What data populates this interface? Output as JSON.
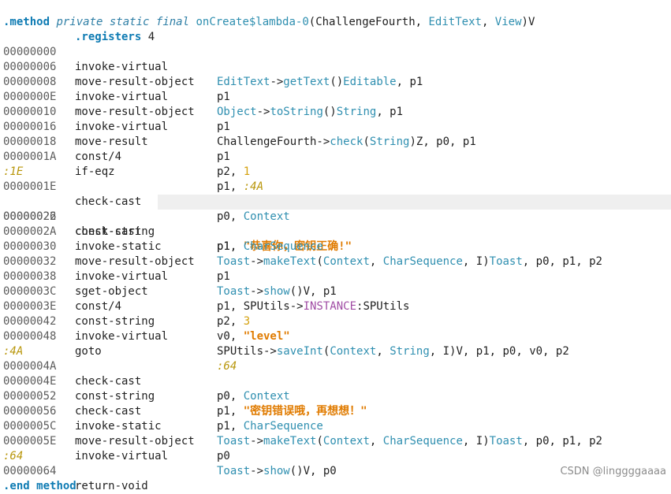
{
  "header": {
    "directive": ".method",
    "modifiers": "private static final",
    "name": "onCreate$lambda-0",
    "open": "(",
    "param1": "ChallengeFourth",
    "comma": ", ",
    "param2": "EditText",
    "comma2": ", ",
    "param3": "View",
    "close": ")V"
  },
  "registers": {
    "directive": ".registers",
    "count": "4"
  },
  "lines": {
    "l0": {
      "off": "00000000",
      "op": "invoke-virtual",
      "a": "EditText",
      "b": "->",
      "c": "getText",
      "d": "()",
      "e": "Editable",
      "f": ", p1"
    },
    "l1": {
      "off": "00000006",
      "op": "move-result-object",
      "a": "p1"
    },
    "l2": {
      "off": "00000008",
      "op": "invoke-virtual",
      "a": "Object",
      "b": "->",
      "c": "toString",
      "d": "()",
      "e": "String",
      "f": ", p1"
    },
    "l3": {
      "off": "0000000E",
      "op": "move-result-object",
      "a": "p1"
    },
    "l4": {
      "off": "00000010",
      "op": "invoke-virtual",
      "a": "ChallengeFourth->",
      "c": "check",
      "d": "(",
      "e": "String",
      "f": ")Z, p0, p1"
    },
    "l5": {
      "off": "00000016",
      "op": "move-result",
      "a": "p1"
    },
    "l6": {
      "off": "00000018",
      "op": "const/4",
      "a": "p2, ",
      "n": "1"
    },
    "l7": {
      "off": "0000001A",
      "op": "if-eqz",
      "a": "p1, ",
      "n": ":4A"
    },
    "lab1": ":1E",
    "l8": {
      "off": "0000001E",
      "op": "check-cast",
      "a": "p0, ",
      "t": "Context"
    },
    "l9": {
      "off": "00000022",
      "op": "const-string",
      "a": "p1, ",
      "s": "\"恭喜你，密钥正确!\""
    },
    "l10": {
      "off": "00000026",
      "op": "check-cast",
      "a": "p1, ",
      "t": "CharSequence"
    },
    "l11": {
      "off": "0000002A",
      "op": "invoke-static",
      "a": "Toast",
      "b": "->",
      "c": "makeText",
      "d": "(",
      "e": "Context",
      "g": ", ",
      "h": "CharSequence",
      "i": ", I)",
      "j": "Toast",
      "f": ", p0, p1, p2"
    },
    "l12": {
      "off": "00000030",
      "op": "move-result-object",
      "a": "p1"
    },
    "l13": {
      "off": "00000032",
      "op": "invoke-virtual",
      "a": "Toast",
      "b": "->",
      "c": "show",
      "f": "()V, p1"
    },
    "l14": {
      "off": "00000038",
      "op": "sget-object",
      "a": "p1, SPUtils->",
      "c": "INSTANCE",
      "f": ":SPUtils"
    },
    "l15": {
      "off": "0000003C",
      "op": "const/4",
      "a": "p2, ",
      "n": "3"
    },
    "l16": {
      "off": "0000003E",
      "op": "const-string",
      "a": "v0, ",
      "s": "\"level\""
    },
    "l17": {
      "off": "00000042",
      "op": "invoke-virtual",
      "a": "SPUtils->",
      "c": "saveInt",
      "d": "(",
      "e": "Context",
      "g": ", ",
      "h": "String",
      "f": ", I)V, p1, p0, v0, p2"
    },
    "l18": {
      "off": "00000048",
      "op": "goto",
      "n": ":64"
    },
    "lab2": ":4A",
    "l19": {
      "off": "0000004A",
      "op": "check-cast",
      "a": "p0, ",
      "t": "Context"
    },
    "l20": {
      "off": "0000004E",
      "op": "const-string",
      "a": "p1, ",
      "s": "\"密钥错误哦，再想想！\""
    },
    "l21": {
      "off": "00000052",
      "op": "check-cast",
      "a": "p1, ",
      "t": "CharSequence"
    },
    "l22": {
      "off": "00000056",
      "op": "invoke-static",
      "a": "Toast",
      "b": "->",
      "c": "makeText",
      "d": "(",
      "e": "Context",
      "g": ", ",
      "h": "CharSequence",
      "i": ", I)",
      "j": "Toast",
      "f": ", p0, p1, p2"
    },
    "l23": {
      "off": "0000005C",
      "op": "move-result-object",
      "a": "p0"
    },
    "l24": {
      "off": "0000005E",
      "op": "invoke-virtual",
      "a": "Toast",
      "b": "->",
      "c": "show",
      "d": "()",
      "f": "V, p0"
    },
    "lab3": ":64",
    "l25": {
      "off": "00000064",
      "op": "return-void"
    }
  },
  "footer": {
    "directive": ".end",
    "word": "method"
  },
  "watermark": "CSDN @linggggaaaa"
}
